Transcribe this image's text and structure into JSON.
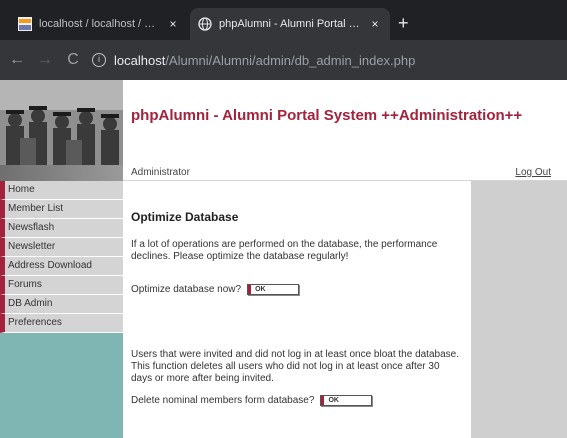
{
  "browser": {
    "tabs": [
      {
        "title": "localhost / localhost / mysql / us",
        "close": "×",
        "icon": "phpmyadmin-icon"
      },
      {
        "title": "phpAlumni - Alumni Portal Syster",
        "close": "×",
        "icon": "globe-icon"
      }
    ],
    "new_tab": "+",
    "nav": {
      "back": "←",
      "forward": "→",
      "reload": "C"
    },
    "url": {
      "host": "localhost",
      "path": "/Alumni/Alumni/admin/db_admin_index.php"
    }
  },
  "header": {
    "title": "phpAlumni - Alumni Portal System ++Administration++"
  },
  "userbar": {
    "user": "Administrator",
    "logout": "Log Out"
  },
  "sidebar": {
    "items": [
      {
        "label": "Home"
      },
      {
        "label": "Member List"
      },
      {
        "label": "Newsflash"
      },
      {
        "label": "Newsletter"
      },
      {
        "label": "Address Download"
      },
      {
        "label": "Forums"
      },
      {
        "label": "DB Admin"
      },
      {
        "label": "Preferences"
      }
    ]
  },
  "main": {
    "heading": "Optimize Database",
    "optimize_text": "If a lot of operations are performed on the database, the performance declines. Please optimize the database regularly!",
    "optimize_prompt": "Optimize database now?",
    "optimize_button": "OK",
    "delete_text": "Users that were invited and did not log in at least once bloat the database. This function deletes all users who did not log in at least once after 30 days or more after being invited.",
    "delete_prompt": "Delete nominal members form database?",
    "delete_button": "OK"
  },
  "colors": {
    "accent": "#a3223c",
    "sidebar_bg": "#7fb6b3",
    "menu_bg": "#d4d4d4",
    "right_col": "#cfcfcf",
    "chrome_dark": "#202124"
  }
}
